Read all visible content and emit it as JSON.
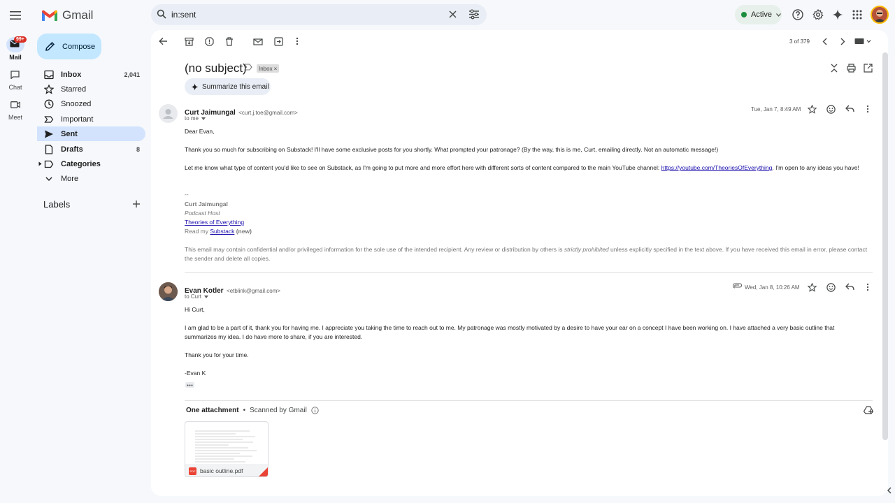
{
  "app": {
    "name": "Gmail",
    "mail_badge": "99+"
  },
  "search": {
    "value": "in:sent"
  },
  "status": {
    "label": "Active"
  },
  "rail": {
    "mail": "Mail",
    "chat": "Chat",
    "meet": "Meet"
  },
  "compose": {
    "label": "Compose"
  },
  "nav": [
    {
      "label": "Inbox",
      "count": "2,041"
    },
    {
      "label": "Starred",
      "count": ""
    },
    {
      "label": "Snoozed",
      "count": ""
    },
    {
      "label": "Important",
      "count": ""
    },
    {
      "label": "Sent",
      "count": ""
    },
    {
      "label": "Drafts",
      "count": "8"
    },
    {
      "label": "Categories",
      "count": ""
    },
    {
      "label": "More",
      "count": ""
    }
  ],
  "labels": {
    "heading": "Labels"
  },
  "thread": {
    "pager": "3 of 379",
    "subject": "(no subject)",
    "inbox_chip": "Inbox",
    "summarize": "Summarize this email",
    "messages": [
      {
        "sender": "Curt Jaimungal",
        "email": "<curt.j.toe@gmail.com>",
        "to": "to me",
        "date": "Tue, Jan 7, 8:49 AM",
        "greeting": "Dear Evan,",
        "p1": "Thank you so much for subscribing on Substack! I'll have some exclusive posts for you shortly. What prompted your patronage? (By the way, this is me, Curt, emailing directly. Not an automatic message!)",
        "p2_before": "Let me know what type of content you'd like to see on Substack, as I'm going to put more and more effort here with different sorts of content compared to the main YouTube channel: ",
        "p2_link": "https://youtube.com/TheoriesOfEverything",
        "p2_after": ". I'm open to any ideas you have!",
        "sig_dash": "--",
        "sig_name": "Curt Jaimungal",
        "sig_role": "Podcast Host",
        "sig_link": "Theories of Everything",
        "sig_read": "Read my ",
        "sig_substack": "Substack",
        "sig_new": " (new)",
        "disc_a": "This email may contain confidential and/or privileged information for the sole use of the intended recipient. Any review or distribution by others is ",
        "disc_em": "strictly prohibited",
        "disc_b": " unless explicitly specified in the text above. If you have received this email in error, please contact the sender and delete all copies."
      },
      {
        "sender": "Evan Kotler",
        "email": "<etblink@gmail.com>",
        "to": "to Curt",
        "date": "Wed, Jan 8, 10:26 AM",
        "greeting": "Hi Curt,",
        "p1": "I am glad to be a part of it, thank you for having me. I appreciate you taking the time to reach out to me. My patronage was mostly motivated by a desire to have your ear on a concept I have been working on. I have attached a very basic outline that summarizes my idea. I do have more to share, if you are interested.",
        "p2": "Thank you for your time.",
        "sign": "-Evan K"
      }
    ],
    "attachment": {
      "heading": "One attachment",
      "scanned": "Scanned by Gmail",
      "filename": "basic outline.pdf",
      "badge": "PDF"
    }
  }
}
